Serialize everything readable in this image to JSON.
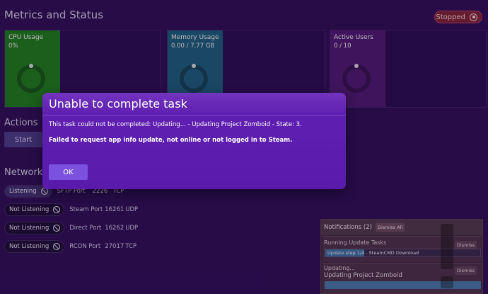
{
  "page_title": "Metrics and Status",
  "status": {
    "label": "Stopped",
    "icon": "stop-icon",
    "color": "#7a2434"
  },
  "metrics": [
    {
      "title": "CPU Usage",
      "value": "0%",
      "color": "#1f7a1d",
      "ring_level": 0
    },
    {
      "title": "Memory Usage",
      "value": "0.00 / 7.77 GB",
      "color": "#1c5c78",
      "ring_level": 0
    },
    {
      "title": "Active Users",
      "value": "0 / 10",
      "color": "#4c1a6e",
      "ring_level": 0
    }
  ],
  "actions": {
    "title": "Actions",
    "start_label": "Start"
  },
  "network": {
    "title": "Network",
    "rows": [
      {
        "state": "Listening",
        "name": "SFTP Port",
        "port": "2226",
        "protocol": "TCP"
      },
      {
        "state": "Not Listening",
        "name": "Steam Port",
        "port": "16261",
        "protocol": "UDP"
      },
      {
        "state": "Not Listening",
        "name": "Direct Port",
        "port": "16262",
        "protocol": "UDP"
      },
      {
        "state": "Not Listening",
        "name": "RCON Port",
        "port": "27017",
        "protocol": "TCP"
      }
    ]
  },
  "modal": {
    "title": "Unable to complete task",
    "message": "This task could not be completed: Updating... - Updating Project Zomboid - State: 3.",
    "detail": "Failed to request app info update, not online or not logged in to Steam.",
    "ok_label": "OK"
  },
  "notifications": {
    "title": "Notifications (2)",
    "dismiss_all_label": "Dismiss All",
    "items": [
      {
        "title": "Running Update Tasks",
        "dismiss_label": "Dismiss",
        "step_label": "Update step 1/4",
        "step_text": "Update step 1/4 - SteamCMD Download",
        "step_progress": 0.25
      },
      {
        "title": "Updating...",
        "dismiss_label": "Dismiss",
        "subtitle": "Updating Project Zomboid",
        "progress": 1.0
      }
    ]
  },
  "colors": {
    "background": "#2d1054",
    "modal": "#5f1fb0",
    "accent": "#7b52e0"
  }
}
